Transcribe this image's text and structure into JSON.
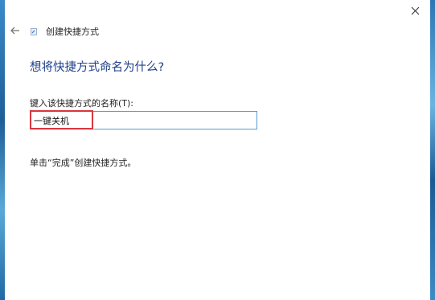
{
  "window": {
    "title": "创建快捷方式",
    "close_icon": "close-icon",
    "back_icon": "back-arrow-icon"
  },
  "page": {
    "heading": "想将快捷方式命名为什么?",
    "field_label": "键入该快捷方式的名称(T):",
    "name_value": "一键关机",
    "instruction": "单击“完成”创建快捷方式。"
  },
  "colors": {
    "heading": "#1e3f8a",
    "input_border": "#5b9bd5",
    "highlight": "#d9363e"
  }
}
